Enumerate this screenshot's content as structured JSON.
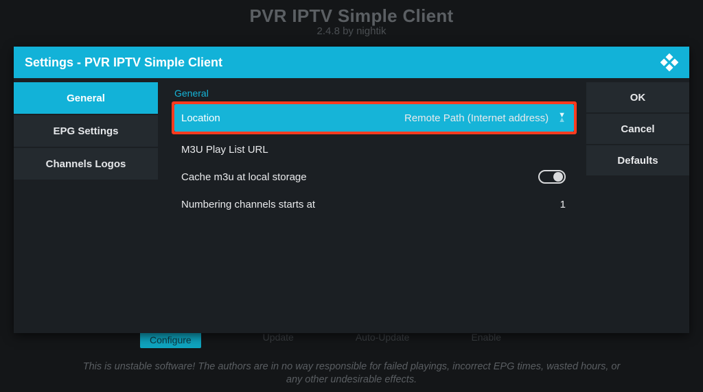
{
  "background": {
    "title": "PVR IPTV Simple Client",
    "version_line": "2.4.8 by nightik",
    "action_row": [
      "Configure",
      "Update",
      "Auto-Update",
      "Enable",
      ""
    ],
    "footer_line1": "This is unstable software! The authors are in no way responsible for failed playings, incorrect EPG times, wasted hours, or",
    "footer_line2": "any other undesirable effects."
  },
  "dialog": {
    "title": "Settings - PVR IPTV Simple Client"
  },
  "sidebar": {
    "items": [
      {
        "label": "General",
        "active": true
      },
      {
        "label": "EPG Settings",
        "active": false
      },
      {
        "label": "Channels Logos",
        "active": false
      }
    ]
  },
  "section": {
    "heading": "General",
    "settings": {
      "location": {
        "label": "Location",
        "value": "Remote Path (Internet address)"
      },
      "m3u_url": {
        "label": "M3U Play List URL",
        "value": ""
      },
      "cache": {
        "label": "Cache m3u at local storage",
        "enabled": true
      },
      "numbering": {
        "label": "Numbering channels starts at",
        "value": "1"
      }
    }
  },
  "actions": {
    "ok": "OK",
    "cancel": "Cancel",
    "defaults": "Defaults"
  }
}
